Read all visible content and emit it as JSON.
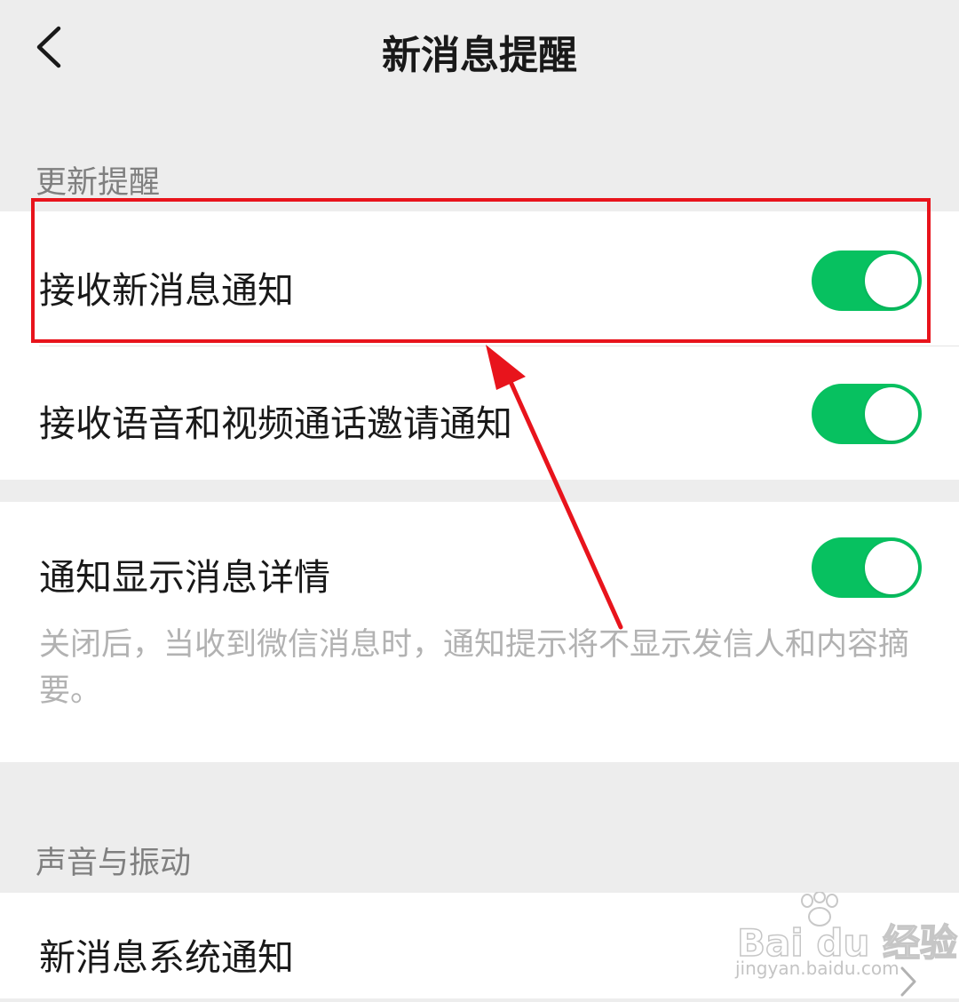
{
  "navbar": {
    "title": "新消息提醒",
    "back_icon": "chevron-left-icon"
  },
  "section_update": {
    "header": "更新提醒",
    "rows": [
      {
        "label": "接收新消息通知",
        "toggle": "on"
      },
      {
        "label": "接收语音和视频通话邀请通知",
        "toggle": "on"
      }
    ]
  },
  "section_detail": {
    "label": "通知显示消息详情",
    "toggle": "on",
    "description": "关闭后，当收到微信消息时，通知提示将不显示发信人和内容摘要。"
  },
  "section_sound": {
    "header": "声音与振动",
    "rows": [
      {
        "label": "新消息系统通知",
        "icon": "chevron-right-icon"
      }
    ]
  },
  "annotation": {
    "highlight_color": "#e8141c"
  },
  "watermark": {
    "brand": "Bai du 经验",
    "url": "jingyan.baidu.com"
  },
  "colors": {
    "accent": "#07c160",
    "background": "#ededed",
    "card": "#ffffff"
  }
}
